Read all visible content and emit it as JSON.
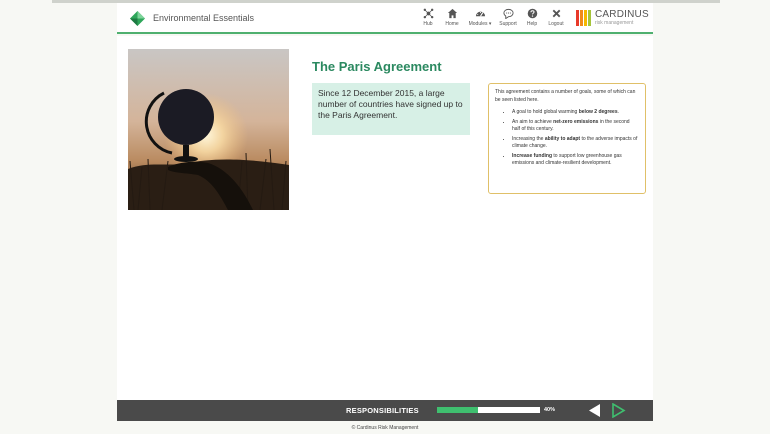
{
  "header": {
    "app_title": "Environmental Essentials",
    "nav": [
      {
        "label": "Hub",
        "icon": "hub-icon"
      },
      {
        "label": "Home",
        "icon": "home-icon"
      },
      {
        "label": "Modules ▾",
        "icon": "modules-icon"
      },
      {
        "label": "Support",
        "icon": "support-icon"
      },
      {
        "label": "Help",
        "icon": "help-icon"
      },
      {
        "label": "Logout",
        "icon": "logout-icon"
      }
    ],
    "brand": {
      "name": "CARDINUS",
      "sub": "risk management",
      "bar_colors": [
        "#e8392a",
        "#f08a1c",
        "#f5b800",
        "#a5c43a"
      ]
    }
  },
  "main": {
    "title": "The Paris Agreement",
    "intro": "Since 12 December 2015, a large number of countries have signed up to the Paris Agreement.",
    "goals": {
      "intro": "This agreement contains a number of goals, some of which can be seen listed here.",
      "items": [
        {
          "pre": "A goal to hold global warming ",
          "bold": "below 2 degrees",
          "post": "."
        },
        {
          "pre": "An aim to achieve ",
          "bold": "net-zero emissions",
          "post": " in the second half of this century."
        },
        {
          "pre": "Increasing the ",
          "bold": "ability to adapt",
          "post": " to the adverse impacts of climate change."
        },
        {
          "pre": "",
          "bold": "Increase funding",
          "post": " to support low greenhouse gas emissions and climate-resilient development."
        }
      ]
    }
  },
  "footer": {
    "section": "RESPONSIBILITIES",
    "progress": 40,
    "progress_label": "40%",
    "copyright": "© Cardinus Risk Management"
  },
  "colors": {
    "accent": "#2b8960",
    "header_rule": "#4fb06f",
    "intro_bg": "#d7f0e6",
    "goals_border": "#e0c068",
    "progress_fill": "#3fbf6f",
    "footer_bg": "#4a4a4a"
  }
}
